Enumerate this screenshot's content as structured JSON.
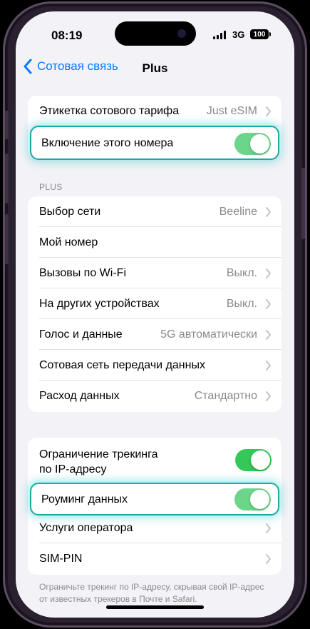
{
  "status": {
    "time": "08:19",
    "network": "3G",
    "battery": "100"
  },
  "nav": {
    "back_label": "Сотовая связь",
    "title": "Plus"
  },
  "group1": {
    "rows": [
      {
        "label": "Этикетка сотового тарифа",
        "value": "Just eSIM"
      },
      {
        "label": "Включение этого номера",
        "toggle": "on"
      }
    ]
  },
  "section_plus": {
    "header": "PLUS"
  },
  "group2": {
    "rows": [
      {
        "label": "Выбор сети",
        "value": "Beeline"
      },
      {
        "label": "Мой номер"
      },
      {
        "label": "Вызовы по Wi-Fi",
        "value": "Выкл."
      },
      {
        "label": "На других устройствах",
        "value": "Выкл."
      },
      {
        "label": "Голос и данные",
        "value": "5G автоматически"
      },
      {
        "label": "Сотовая сеть передачи данных"
      },
      {
        "label": "Расход данных",
        "value": "Стандартно"
      }
    ]
  },
  "group3": {
    "rows": [
      {
        "label_line1": "Ограничение трекинга",
        "label_line2": "по IP-адресу",
        "toggle": "on"
      },
      {
        "label": "Роуминг данных",
        "toggle": "on"
      },
      {
        "label": "Услуги оператора"
      },
      {
        "label": "SIM-PIN"
      }
    ]
  },
  "footer": {
    "note": "Ограничьте трекинг по IP-адресу, скрывая свой IP-адрес от известных трекеров в Почте и Safari."
  },
  "colors": {
    "accent": "#0a7aff",
    "toggle_on": "#34c759",
    "highlight": "#1ba8a8"
  }
}
